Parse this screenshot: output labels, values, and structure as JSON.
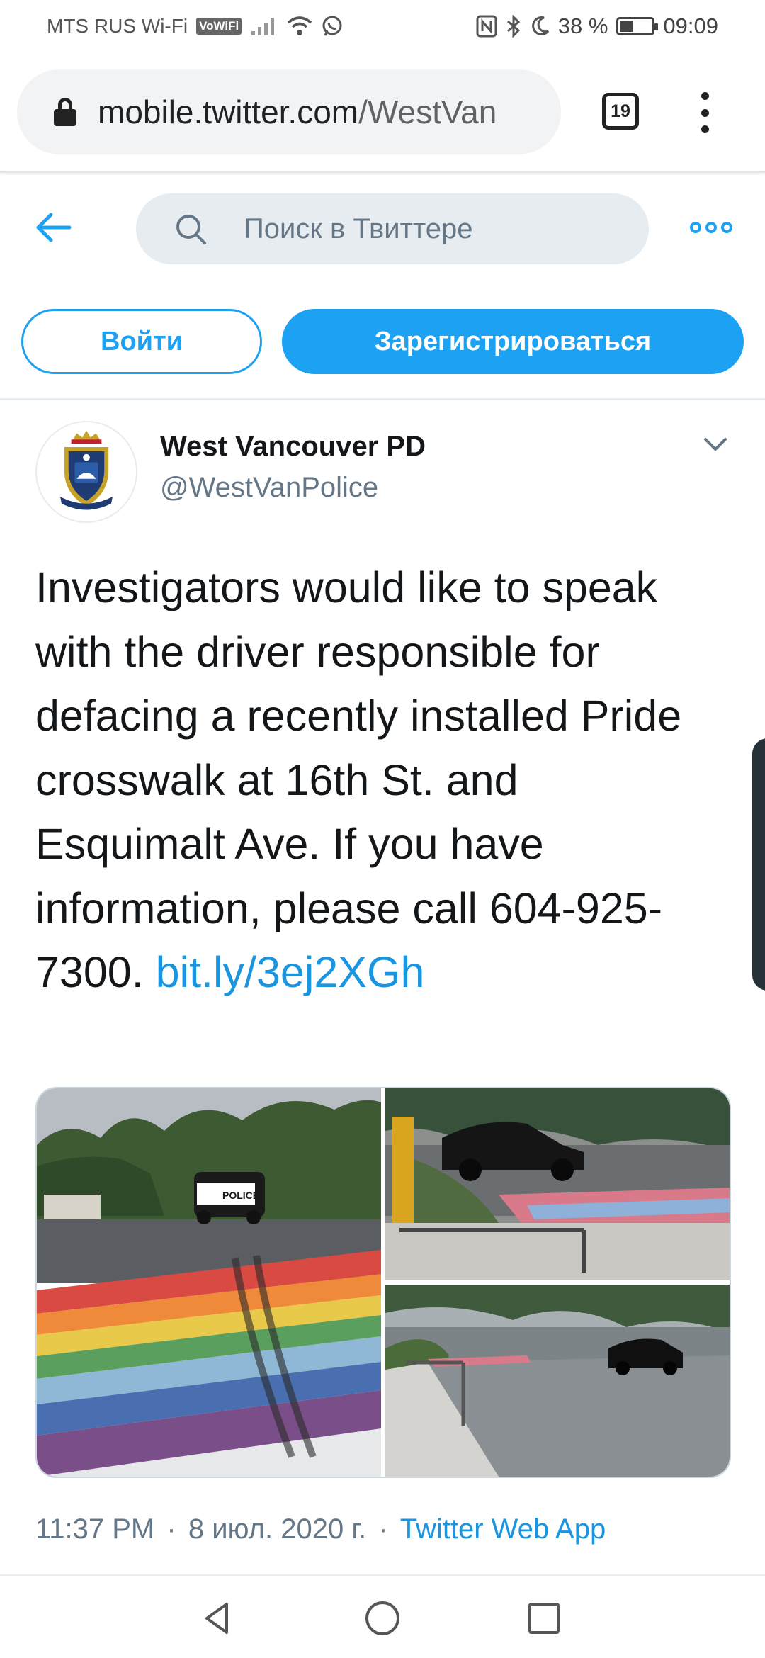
{
  "status_bar": {
    "carrier": "MTS RUS Wi-Fi",
    "vowifi": "VoWiFi",
    "battery_pct": "38 %",
    "battery_level": 0.38,
    "time": "09:09"
  },
  "browser": {
    "url_host": "mobile.twitter.com",
    "url_path": "/WestVan",
    "tab_count": "19"
  },
  "header": {
    "search_placeholder": "Поиск в Твиттере"
  },
  "auth": {
    "login_label": "Войти",
    "signup_label": "Зарегистрироваться"
  },
  "tweet": {
    "display_name": "West Vancouver PD",
    "handle": "@WestVanPolice",
    "text": "Investigators would like to speak with the driver responsible for defacing a recently installed Pride crosswalk at 16th St. and Esquimalt Ave. If you have information, please call 604-925-7300. ",
    "link": "bit.ly/3ej2XGh",
    "time": "11:37 PM",
    "date": "8 июл. 2020 г.",
    "source": "Twitter Web App",
    "separator": "·",
    "police_car_label": "POLICE"
  },
  "colors": {
    "twitter_blue": "#1da1f2",
    "link_blue": "#1b95e0",
    "muted_text": "#657786",
    "search_bg": "#e6ecf0"
  }
}
